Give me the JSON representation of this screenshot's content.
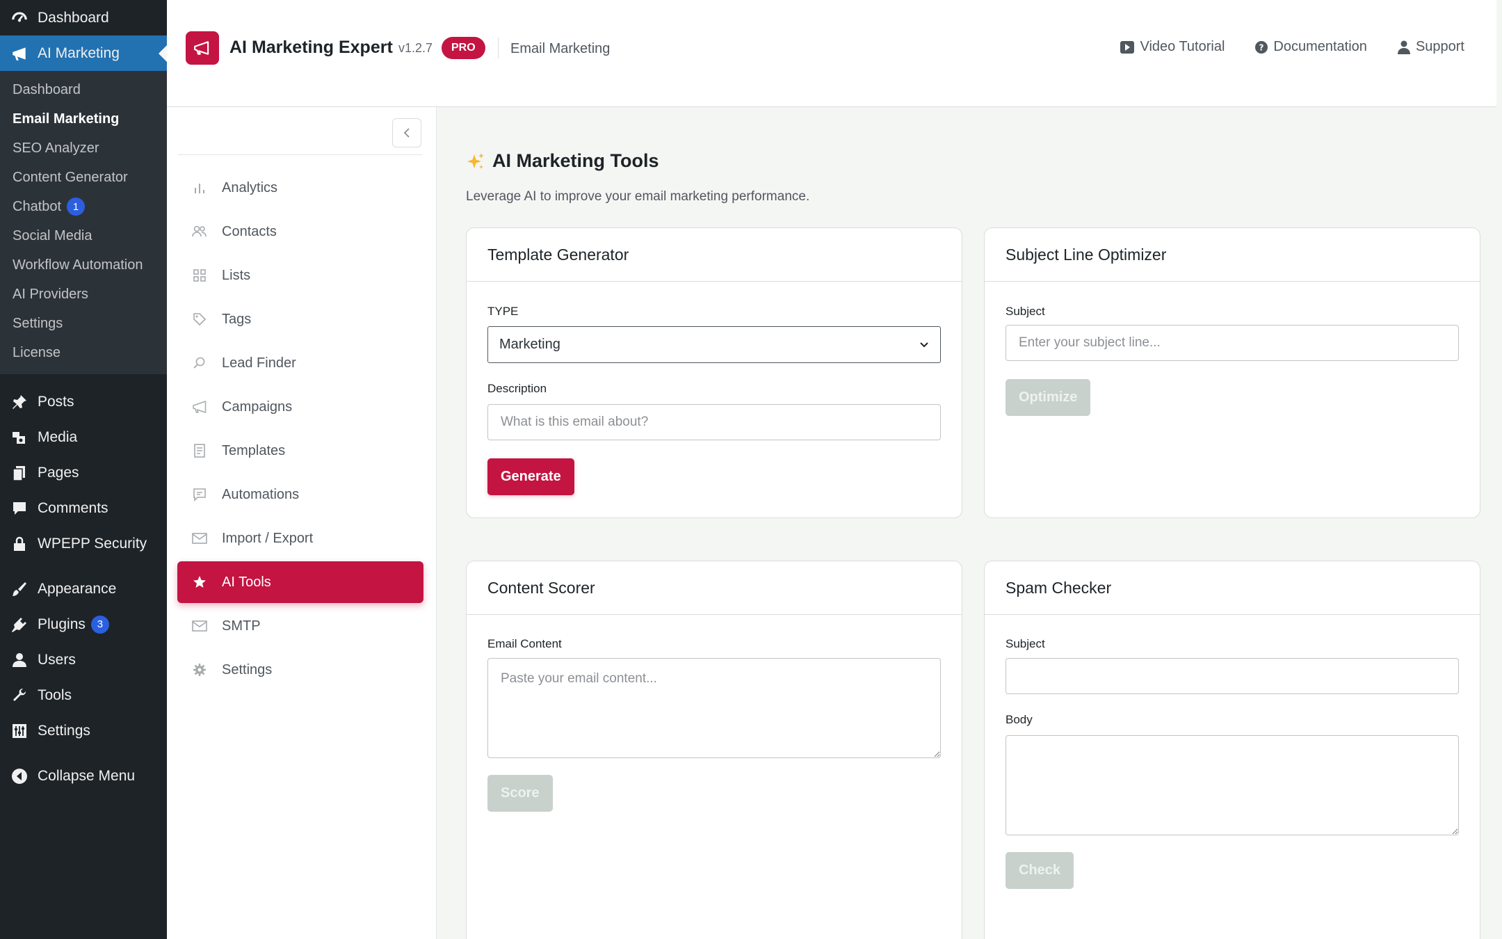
{
  "wp_menu": {
    "dashboard": "Dashboard",
    "ai_marketing": "AI Marketing",
    "submenu": [
      {
        "label": "Dashboard"
      },
      {
        "label": "Email Marketing"
      },
      {
        "label": "SEO Analyzer"
      },
      {
        "label": "Content Generator"
      },
      {
        "label": "Chatbot",
        "badge": "1"
      },
      {
        "label": "Social Media"
      },
      {
        "label": "Workflow Automation"
      },
      {
        "label": "AI Providers"
      },
      {
        "label": "Settings"
      },
      {
        "label": "License"
      }
    ],
    "posts": "Posts",
    "media": "Media",
    "pages": "Pages",
    "comments": "Comments",
    "security": "WPEPP Security",
    "appearance": "Appearance",
    "plugins": "Plugins",
    "plugins_badge": "3",
    "users": "Users",
    "tools": "Tools",
    "settings": "Settings",
    "collapse": "Collapse Menu"
  },
  "header": {
    "title": "AI Marketing Expert",
    "version": "v1.2.7",
    "badge": "PRO",
    "section": "Email Marketing",
    "links": {
      "video": "Video Tutorial",
      "docs": "Documentation",
      "support": "Support"
    }
  },
  "plugin_nav": {
    "items": [
      {
        "label": "Analytics"
      },
      {
        "label": "Contacts"
      },
      {
        "label": "Lists"
      },
      {
        "label": "Tags"
      },
      {
        "label": "Lead Finder"
      },
      {
        "label": "Campaigns"
      },
      {
        "label": "Templates"
      },
      {
        "label": "Automations"
      },
      {
        "label": "Import / Export"
      },
      {
        "label": "AI Tools"
      },
      {
        "label": "SMTP"
      },
      {
        "label": "Settings"
      }
    ]
  },
  "main": {
    "title": "AI Marketing Tools",
    "subtitle": "Leverage AI to improve your email marketing performance.",
    "template_generator": {
      "title": "Template Generator",
      "type_label": "TYPE",
      "type_value": "Marketing",
      "description_label": "Description",
      "description_placeholder": "What is this email about?",
      "button": "Generate"
    },
    "subject_optimizer": {
      "title": "Subject Line Optimizer",
      "subject_label": "Subject",
      "subject_placeholder": "Enter your subject line...",
      "button": "Optimize"
    },
    "content_scorer": {
      "title": "Content Scorer",
      "content_label": "Email Content",
      "content_placeholder": "Paste your email content...",
      "button": "Score"
    },
    "spam_checker": {
      "title": "Spam Checker",
      "subject_label": "Subject",
      "body_label": "Body",
      "button": "Check"
    }
  },
  "colors": {
    "accent": "#c41442",
    "wp_sidebar": "#1d2327",
    "wp_active": "#2271b1",
    "disabled_button": "#c8d1cc"
  }
}
